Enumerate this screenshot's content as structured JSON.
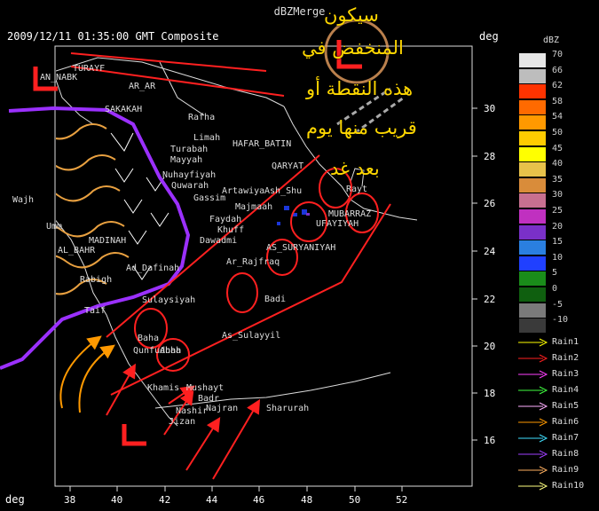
{
  "window": {
    "title": "dBZMerge"
  },
  "header": {
    "timestamp": "2009/12/11 01:35:00 GMT Composite",
    "unit_top_right": "deg",
    "unit_bottom_left": "deg"
  },
  "axes": {
    "y_ticks": [
      "30",
      "28",
      "26",
      "24",
      "22",
      "20",
      "18",
      "16"
    ],
    "x_ticks": [
      "38",
      "40",
      "42",
      "44",
      "46",
      "48",
      "50",
      "52"
    ]
  },
  "legend": {
    "title": "dBZ",
    "levels": [
      {
        "label": "70",
        "color": "#e6e6e6"
      },
      {
        "label": "66",
        "color": "#bdbdbd"
      },
      {
        "label": "62",
        "color": "#ff3300"
      },
      {
        "label": "58",
        "color": "#ff6a00"
      },
      {
        "label": "54",
        "color": "#ff9900"
      },
      {
        "label": "50",
        "color": "#ffcc00"
      },
      {
        "label": "45",
        "color": "#ffff00"
      },
      {
        "label": "40",
        "color": "#e8c24a"
      },
      {
        "label": "35",
        "color": "#d98c3a"
      },
      {
        "label": "30",
        "color": "#c87090"
      },
      {
        "label": "25",
        "color": "#c030c0"
      },
      {
        "label": "20",
        "color": "#7a30c8"
      },
      {
        "label": "15",
        "color": "#2a7fe0"
      },
      {
        "label": "10",
        "color": "#2040ff"
      },
      {
        "label": "5",
        "color": "#1a8c1a"
      },
      {
        "label": "0",
        "color": "#0f5f0f"
      },
      {
        "label": "-5",
        "color": "#7a7a7a"
      },
      {
        "label": "-10",
        "color": "#3a3a3a"
      }
    ],
    "rain": [
      {
        "label": "Rain1",
        "color": "#ffff00"
      },
      {
        "label": "Rain2",
        "color": "#ff2020"
      },
      {
        "label": "Rain3",
        "color": "#ff40ff"
      },
      {
        "label": "Rain4",
        "color": "#40ff40"
      },
      {
        "label": "Rain5",
        "color": "#ffb0ff"
      },
      {
        "label": "Rain6",
        "color": "#ff9900"
      },
      {
        "label": "Rain7",
        "color": "#40e0ff"
      },
      {
        "label": "Rain8",
        "color": "#a040ff"
      },
      {
        "label": "Rain9",
        "color": "#ffb060"
      },
      {
        "label": "Rain10",
        "color": "#ffff80"
      }
    ]
  },
  "places": {
    "an_nabk": "AN_NABK",
    "turaif": "TURAYF",
    "ar_ar": "AR_AR",
    "sakakah": "SAKAKAH",
    "rafha": "Rafha",
    "limah": "Limah",
    "hafar_batin": "HAFAR_BATIN",
    "qaryat": "QARYAT",
    "turabah": "Turabah",
    "mayyah": "Mayyah",
    "nuhayfiyah": "Nuhayfiyah",
    "qwwarah": "Quwarah",
    "gassim": "Gassim",
    "artawiya": "Artawiya",
    "ash_shu": "Ash_Shu",
    "majmaah": "Majmaah",
    "faydah": "Faydah",
    "khuff": "Khuff",
    "dawadmi": "Dawadmi",
    "rayt": "Rayt",
    "mubarraz": "MUBARRAZ",
    "hufuf": "UFAYIYAH",
    "suryaniyah": "AS_SURYANIYAH",
    "rajfraq": "Ar_Rajfraq",
    "badi": "Badi",
    "madinah": "MADINAH",
    "bahr": "AL_BAHR",
    "dafinah": "Ad_Dafinah",
    "rabigh": "Rabigh",
    "umm": "Umm",
    "wajh": "Wajh",
    "sulaysiyah": "Sulaysiyah",
    "sulayyil": "As_Sulayyil",
    "khamis": "Khamis",
    "nayt": "Mushayt",
    "badr": "Badr",
    "najran": "Najran",
    "sharurah": "Sharurah",
    "baha": "Baha",
    "qunfudhah": "Qunfudhah",
    "abha": "Abha",
    "jizan": "Jizan",
    "nashir": "Nashir",
    "taif": "Taif"
  },
  "annotation": {
    "line1": "سيكون",
    "line2": "المنخفض في",
    "line3": "هذه النقطة أو",
    "line4": "قريب منها يوم",
    "line5": "بعد غد"
  },
  "colors": {
    "outline": "#ffffff",
    "annotation_red": "#ff2020",
    "annotation_purple": "#9b30ff",
    "annotation_orange": "#ff9900",
    "arrow_white": "#ffffff"
  }
}
